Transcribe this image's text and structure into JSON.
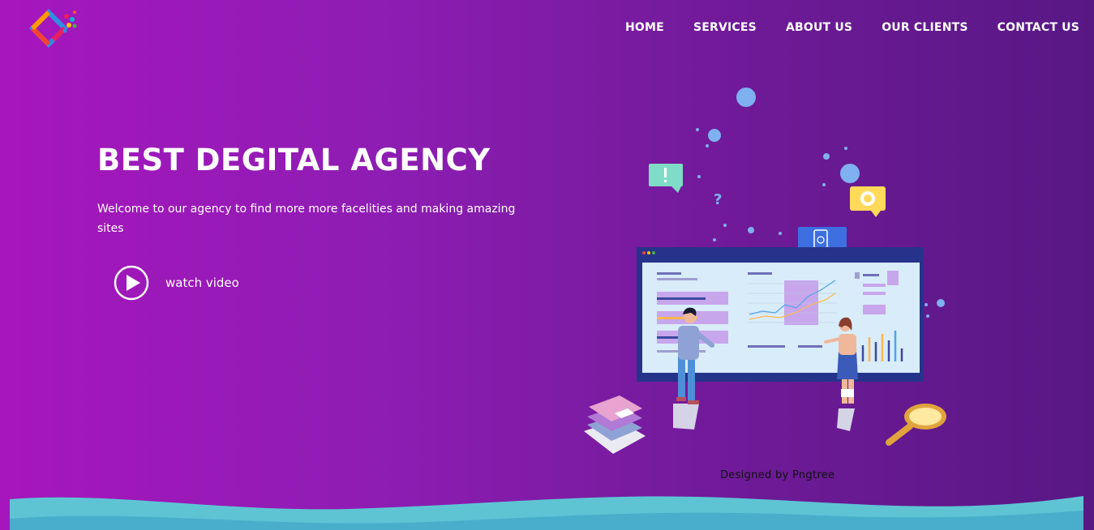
{
  "brand": {
    "logo_icon": "multicolor-diamond-logo",
    "colors": [
      "#2f8de4",
      "#f44336",
      "#ffc107",
      "#4caf50",
      "#e91e63",
      "#00bcd4"
    ]
  },
  "nav": {
    "items": [
      {
        "label": "HOME"
      },
      {
        "label": "SERVICES"
      },
      {
        "label": "ABOUT US"
      },
      {
        "label": "OUR CLIENTS"
      },
      {
        "label": "CONTACT US"
      }
    ]
  },
  "hero": {
    "title": "BEST DEGITAL AGENCY",
    "text": "Welcome to our agency to find more more facelities and making amazing sites",
    "watch_label": "watch video",
    "play_icon": "play-circle-icon"
  },
  "illustration": {
    "name": "team-analytics-dashboard-illustration",
    "credit": "Designed by Pngtree"
  },
  "colors": {
    "background_start": "#a616bd",
    "background_end": "#581884",
    "wave": "#5ec4d4",
    "text": "#ffffff"
  }
}
